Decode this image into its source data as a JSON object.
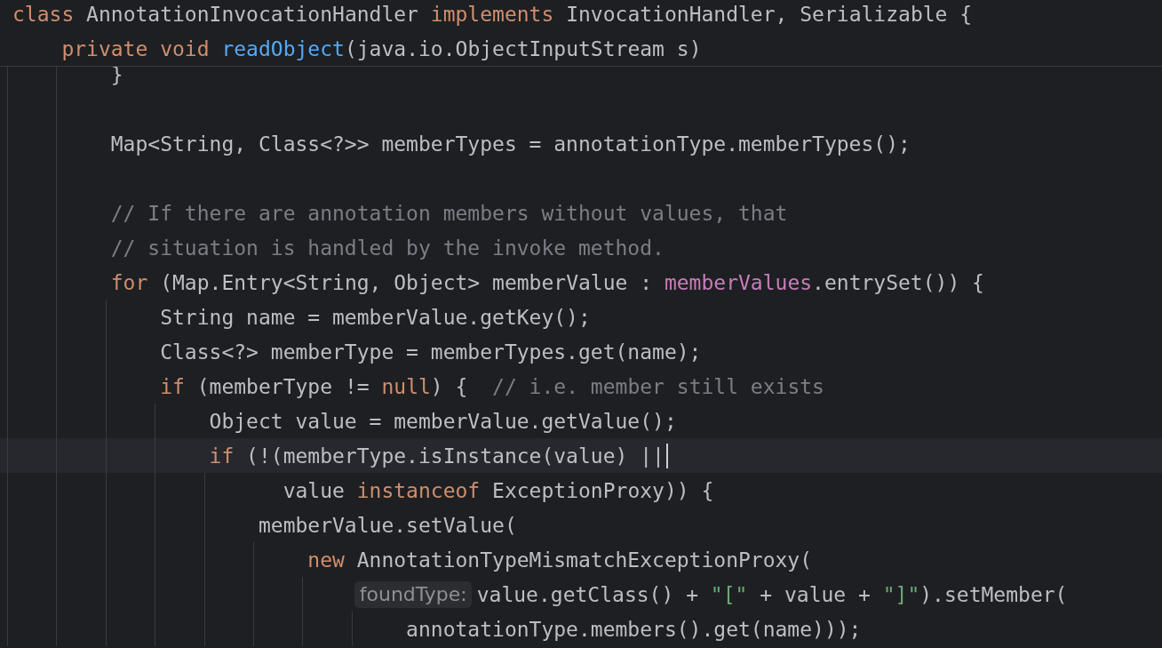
{
  "sticky_header": {
    "lines": [
      {
        "tokens": [
          {
            "t": "class",
            "kind": "keyword"
          },
          {
            "t": " AnnotationInvocationHandler ",
            "kind": "plain"
          },
          {
            "t": "implements",
            "kind": "keyword"
          },
          {
            "t": " InvocationHandler, Serializable {",
            "kind": "plain"
          }
        ]
      },
      {
        "tokens": [
          {
            "t": "    private",
            "kind": "keyword"
          },
          {
            "t": " void",
            "kind": "keyword"
          },
          {
            "t": " readObject",
            "kind": "declaration"
          },
          {
            "t": "(java.io.ObjectInputStream s)",
            "kind": "plain"
          }
        ]
      }
    ]
  },
  "editor": {
    "lines": [
      {
        "kind": "code",
        "current": false,
        "tokens": [
          {
            "t": "        }",
            "kind": "plain"
          }
        ]
      },
      {
        "kind": "blank"
      },
      {
        "kind": "code",
        "current": false,
        "tokens": [
          {
            "t": "        Map<String, Class<?>> memberTypes = annotationType.memberTypes();",
            "kind": "plain"
          }
        ]
      },
      {
        "kind": "blank"
      },
      {
        "kind": "code",
        "current": false,
        "tokens": [
          {
            "t": "        // If there are annotation members without values, that",
            "kind": "comment"
          }
        ]
      },
      {
        "kind": "code",
        "current": false,
        "tokens": [
          {
            "t": "        // situation is handled by the invoke method.",
            "kind": "comment"
          }
        ]
      },
      {
        "kind": "code",
        "current": false,
        "tokens": [
          {
            "t": "        for",
            "kind": "keyword"
          },
          {
            "t": " (Map.Entry<String, Object> memberValue : ",
            "kind": "plain"
          },
          {
            "t": "memberValues",
            "kind": "field"
          },
          {
            "t": ".entrySet()) {",
            "kind": "plain"
          }
        ]
      },
      {
        "kind": "code",
        "current": false,
        "tokens": [
          {
            "t": "            String name = memberValue.getKey();",
            "kind": "plain"
          }
        ]
      },
      {
        "kind": "code",
        "current": false,
        "tokens": [
          {
            "t": "            Class<?> memberType = memberTypes.get(name);",
            "kind": "plain"
          }
        ]
      },
      {
        "kind": "code",
        "current": false,
        "tokens": [
          {
            "t": "            if",
            "kind": "keyword"
          },
          {
            "t": " (memberType != ",
            "kind": "plain"
          },
          {
            "t": "null",
            "kind": "keyword"
          },
          {
            "t": ") {  ",
            "kind": "plain"
          },
          {
            "t": "// i.e. member still exists",
            "kind": "comment"
          }
        ]
      },
      {
        "kind": "code",
        "current": false,
        "tokens": [
          {
            "t": "                Object value = memberValue.getValue();",
            "kind": "plain"
          }
        ]
      },
      {
        "kind": "code",
        "current": true,
        "tokens": [
          {
            "t": "                if",
            "kind": "keyword"
          },
          {
            "t": " (!(memberType.isInstance(value) ||",
            "kind": "plain"
          }
        ]
      },
      {
        "kind": "code",
        "current": false,
        "tokens": [
          {
            "t": "                      value ",
            "kind": "plain"
          },
          {
            "t": "instanceof",
            "kind": "keyword"
          },
          {
            "t": " ExceptionProxy)) {",
            "kind": "plain"
          }
        ]
      },
      {
        "kind": "code",
        "current": false,
        "tokens": [
          {
            "t": "                    memberValue.setValue(",
            "kind": "plain"
          }
        ]
      },
      {
        "kind": "code",
        "current": false,
        "tokens": [
          {
            "t": "                        new",
            "kind": "keyword"
          },
          {
            "t": " AnnotationTypeMismatchExceptionProxy(",
            "kind": "plain"
          }
        ]
      },
      {
        "kind": "code",
        "current": false,
        "tokens": [
          {
            "t": "                            foundType:",
            "kind": "hint"
          },
          {
            "t": "value.getClass() + ",
            "kind": "plain"
          },
          {
            "t": "\"[\"",
            "kind": "string"
          },
          {
            "t": " + value + ",
            "kind": "plain"
          },
          {
            "t": "\"]\"",
            "kind": "string"
          },
          {
            "t": ").setMember(",
            "kind": "plain"
          }
        ]
      },
      {
        "kind": "code",
        "current": false,
        "tokens": [
          {
            "t": "                                annotationType.members().get(name)));",
            "kind": "plain"
          }
        ]
      }
    ]
  }
}
